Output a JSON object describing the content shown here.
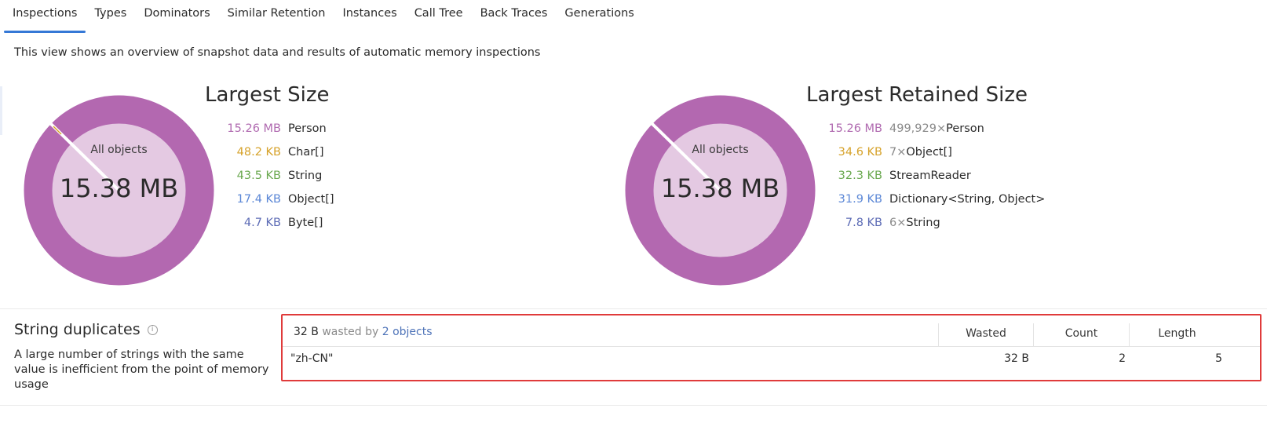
{
  "tabs": [
    {
      "label": "Inspections",
      "active": true
    },
    {
      "label": "Types"
    },
    {
      "label": "Dominators"
    },
    {
      "label": "Similar Retention"
    },
    {
      "label": "Instances"
    },
    {
      "label": "Call Tree"
    },
    {
      "label": "Back Traces"
    },
    {
      "label": "Generations"
    }
  ],
  "intro": "This view shows an overview of snapshot data and results of automatic memory inspections",
  "colors": {
    "accent": "#3578d6",
    "donut_outer": "#b368b0",
    "donut_inner": "#e4c9e2",
    "purple": "#b06ab0",
    "orange": "#d6a22a",
    "green": "#6aa84f",
    "blue": "#5b87d6",
    "indigo": "#5c6bb5",
    "highlight_border": "#e03b3b"
  },
  "largest_size": {
    "title": "Largest Size",
    "donut_label": "All objects",
    "donut_total": "15.38 MB",
    "items": [
      {
        "size": "15.26 MB",
        "count": "",
        "name": "Person",
        "color": "#b06ab0"
      },
      {
        "size": "48.2 KB",
        "count": "",
        "name": "Char[]",
        "color": "#d6a22a"
      },
      {
        "size": "43.5 KB",
        "count": "",
        "name": "String",
        "color": "#6aa84f"
      },
      {
        "size": "17.4 KB",
        "count": "",
        "name": "Object[]",
        "color": "#5b87d6"
      },
      {
        "size": "4.7 KB",
        "count": "",
        "name": "Byte[]",
        "color": "#5c6bb5"
      }
    ]
  },
  "largest_retained_size": {
    "title": "Largest Retained Size",
    "donut_label": "All objects",
    "donut_total": "15.38 MB",
    "items": [
      {
        "size": "15.26 MB",
        "count": "499,929×",
        "name": "Person",
        "color": "#b06ab0"
      },
      {
        "size": "34.6 KB",
        "count": "7×",
        "name": "Object[]",
        "color": "#d6a22a"
      },
      {
        "size": "32.3 KB",
        "count": "",
        "name": "StreamReader",
        "color": "#6aa84f"
      },
      {
        "size": "31.9 KB",
        "count": "",
        "name": "Dictionary<String, Object>",
        "color": "#5b87d6"
      },
      {
        "size": "7.8 KB",
        "count": "6×",
        "name": "String",
        "color": "#5c6bb5"
      }
    ]
  },
  "string_duplicates": {
    "title": "String duplicates",
    "info_icon": "info-icon",
    "description": "A large number of strings with the same value is inefficient from the point of memory usage",
    "summary_amount": "32 B",
    "summary_wasted_by": "wasted by",
    "summary_link": "2 objects",
    "columns": [
      "Wasted",
      "Count",
      "Length"
    ],
    "rows": [
      {
        "value": "\"zh-CN\"",
        "wasted": "32 B",
        "count": "2",
        "length": "5"
      }
    ]
  }
}
